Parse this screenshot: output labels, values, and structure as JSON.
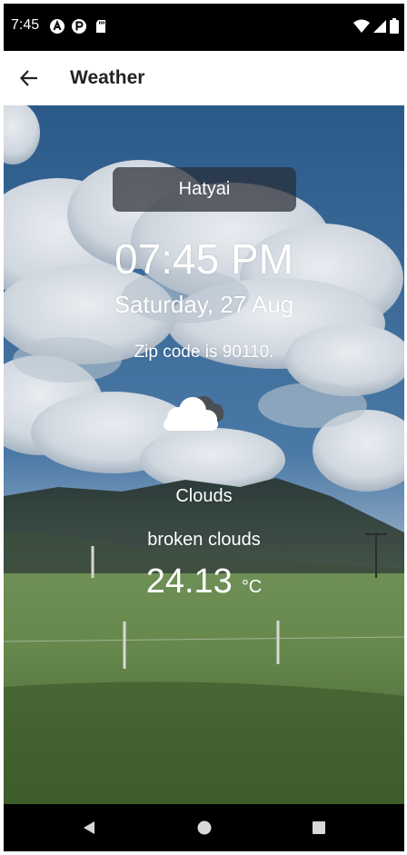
{
  "status_bar": {
    "time": "7:45",
    "left_icons": [
      "a-circle-icon",
      "p-circle-icon",
      "sd-card-icon"
    ],
    "right_icons": [
      "wifi-icon",
      "signal-icon",
      "battery-icon"
    ]
  },
  "app_bar": {
    "title": "Weather",
    "back_icon": "arrow-left-icon"
  },
  "weather": {
    "city": "Hatyai",
    "time": "07:45 PM",
    "date": "Saturday, 27 Aug",
    "zip_text": "Zip code is 90110.",
    "icon": "broken-clouds-icon",
    "condition": "Clouds",
    "description": "broken clouds",
    "temperature": "24.13",
    "unit": "°C"
  },
  "nav_bar": {
    "buttons": [
      "back-triangle-icon",
      "home-circle-icon",
      "recents-square-icon"
    ]
  },
  "colors": {
    "sky": "#3f6f9d",
    "chip": "#282c36",
    "field": "#5f7f4a"
  }
}
